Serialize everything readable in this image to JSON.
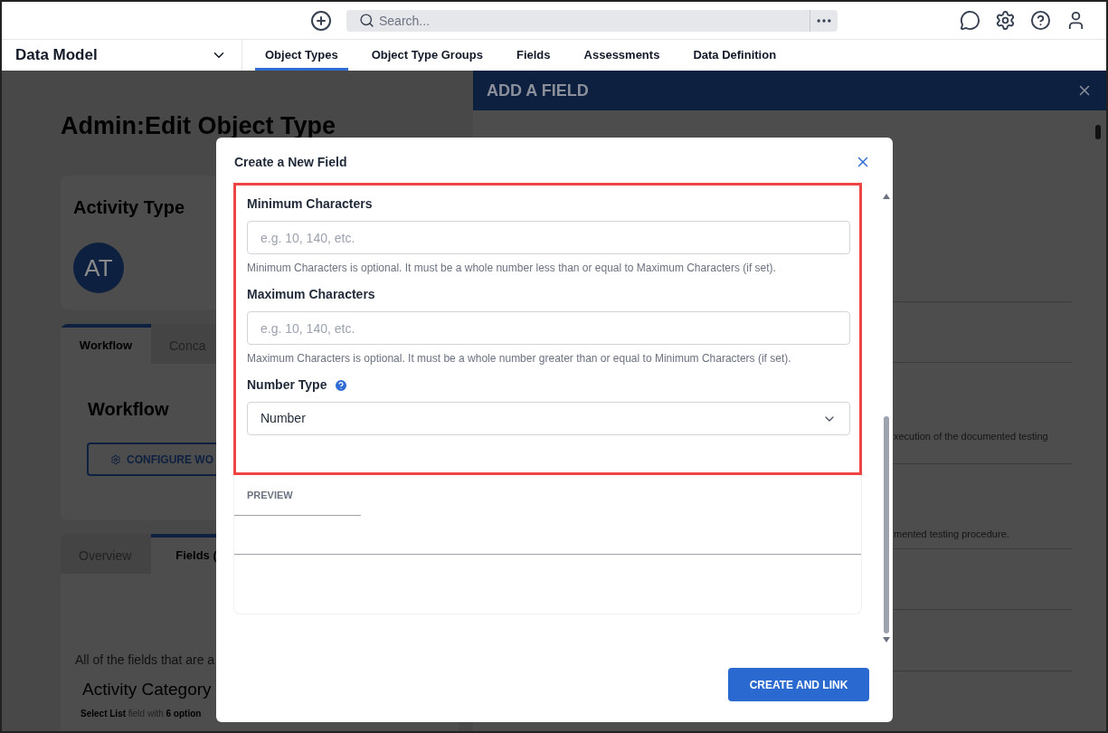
{
  "top_bar": {
    "search": {
      "placeholder": "Search..."
    }
  },
  "nav": {
    "module": "Data Model",
    "tabs": [
      {
        "label": "Object Types",
        "selected": true
      },
      {
        "label": "Object Type Groups",
        "selected": false
      },
      {
        "label": "Fields",
        "selected": false
      },
      {
        "label": "Assessments",
        "selected": false
      },
      {
        "label": "Data Definition",
        "selected": false
      }
    ]
  },
  "page": {
    "title": "Admin:Edit Object Type",
    "record": {
      "name": "Activity Type",
      "avatar": "AT"
    },
    "workflow_card": {
      "tabs": [
        {
          "label": "Workflow",
          "selected": true
        },
        {
          "label": "Conca",
          "selected": false
        }
      ],
      "heading": "Workflow",
      "button": "CONFIGURE WO"
    },
    "fields_card": {
      "tabs": [
        {
          "label": "Overview",
          "selected": false
        },
        {
          "label": "Fields (",
          "selected": true
        }
      ],
      "intro": "All of the fields that are a",
      "field": {
        "name": "Activity Category",
        "description": "**Select List** field with **6 option**"
      }
    }
  },
  "side_panel": {
    "title": "ADD A FIELD",
    "texts": [
      "xecution of the documented testing",
      "mented testing procedure."
    ]
  },
  "modal": {
    "title": "Create a New Field",
    "fields": [
      {
        "kind": "text",
        "label": "Minimum Characters",
        "placeholder": "e.g. 10, 140, etc.",
        "help": "Minimum Characters is optional. It must be a whole number less than or equal to Maximum Characters (if set)."
      },
      {
        "kind": "text",
        "label": "Maximum Characters",
        "placeholder": "e.g. 10, 140, etc.",
        "help": "Maximum Characters is optional. It must be a whole number greater than or equal to Minimum Characters (if set)."
      },
      {
        "kind": "select",
        "label": "Number Type",
        "info": true,
        "value": "Number"
      }
    ],
    "preview": {
      "tab": "PREVIEW"
    },
    "button": "CREATE AND LINK"
  }
}
